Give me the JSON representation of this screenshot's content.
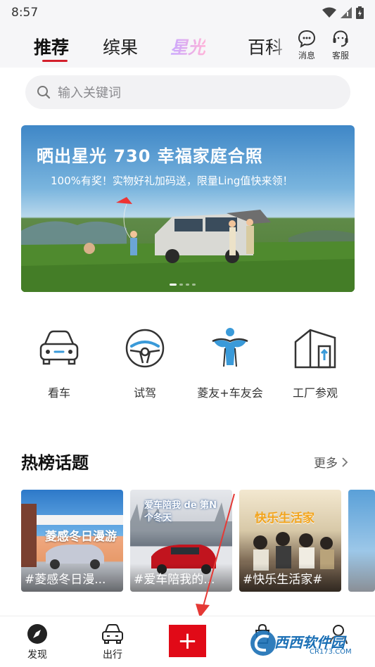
{
  "status": {
    "time": "8:57"
  },
  "tabs": [
    {
      "label": "推荐"
    },
    {
      "label": "缤果"
    },
    {
      "label": "星光"
    },
    {
      "label": "百科"
    }
  ],
  "header_actions": {
    "messages": "消息",
    "service": "客服"
  },
  "search": {
    "placeholder": "输入关键词"
  },
  "banner": {
    "title": "晒出星光 730 幸福家庭合照",
    "subtitle": "100%有奖！实物好礼加码送，限量Ling值快来领！",
    "slide_count": 4,
    "active_slide": 1
  },
  "quick_links": [
    {
      "label": "看车",
      "icon": "car-front-icon"
    },
    {
      "label": "试驾",
      "icon": "steering-wheel-icon"
    },
    {
      "label": "菱友+车友会",
      "icon": "club-figure-icon"
    },
    {
      "label": "工厂参观",
      "icon": "factory-icon"
    }
  ],
  "hot_topics": {
    "title": "热榜话题",
    "more": "更多",
    "items": [
      {
        "label": "#菱感冬日漫...",
        "overlay": "菱感冬日漫游"
      },
      {
        "label": "#爱车陪我的...",
        "overlay": "爱车陪我 de 第N个冬天"
      },
      {
        "label": "#快乐生活家#",
        "overlay": "快乐生活家"
      }
    ]
  },
  "bottom_nav": [
    {
      "label": "发现",
      "icon": "compass-icon"
    },
    {
      "label": "出行",
      "icon": "car-icon"
    },
    {
      "label": "+",
      "icon": "plus-icon"
    },
    {
      "label": "",
      "icon": "bag-icon"
    },
    {
      "label": "",
      "icon": "profile-icon"
    }
  ],
  "watermark": {
    "text": "西西软件园",
    "sub": "CR173.COM"
  },
  "colors": {
    "accent": "#d4202c",
    "plus_button": "#e10a17"
  }
}
